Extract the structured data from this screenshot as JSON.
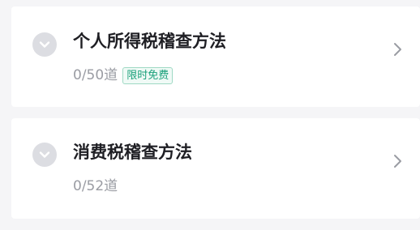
{
  "colors": {
    "background": "#f5f5f7",
    "card": "#ffffff",
    "title": "#1f1f24",
    "muted": "#9a9ca3",
    "badge_text": "#1aa07a",
    "badge_border": "#9fd9c4",
    "expand_icon_bg": "#dcdde2"
  },
  "items": [
    {
      "title": "个人所得税稽查方法",
      "progress": "0/50道",
      "badge": "限时免费",
      "expand_icon": "chevron-down-icon",
      "nav_icon": "chevron-right-icon"
    },
    {
      "title": "消费税稽查方法",
      "progress": "0/52道",
      "expand_icon": "chevron-down-icon",
      "nav_icon": "chevron-right-icon"
    }
  ]
}
